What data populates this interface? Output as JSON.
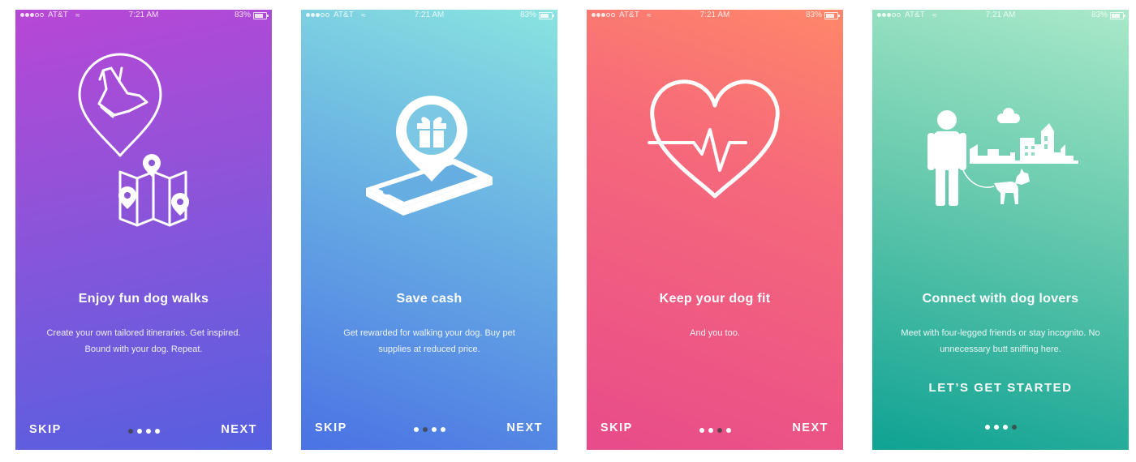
{
  "status_bar": {
    "carrier": "AT&T",
    "time": "7:21 AM",
    "battery": "83%"
  },
  "screens": [
    {
      "title": "Enjoy fun dog walks",
      "description": "Create your own tailored itineraries. Get inspired. Bound with your dog. Repeat.",
      "skip": "SKIP",
      "next": "NEXT",
      "active_page": 1,
      "illustration": "dog-map-pin-icon"
    },
    {
      "title": "Save cash",
      "description": "Get rewarded for walking your dog. Buy pet supplies at reduced price.",
      "skip": "SKIP",
      "next": "NEXT",
      "active_page": 2,
      "illustration": "gift-phone-icon"
    },
    {
      "title": "Keep your dog fit",
      "description": "And you too.",
      "skip": "SKIP",
      "next": "NEXT",
      "active_page": 3,
      "illustration": "heart-pulse-icon"
    },
    {
      "title": "Connect with dog lovers",
      "description": "Meet with four-legged friends or stay incognito. No unnecessary butt sniffing here.",
      "cta": "LET’S GET STARTED",
      "active_page": 4,
      "illustration": "person-dog-city-icon"
    }
  ],
  "page_count": 4,
  "colors": {
    "screen1": [
      "#b847d6",
      "#5560e0"
    ],
    "screen2": [
      "#8ae4e0",
      "#4a72e4"
    ],
    "screen3": [
      "#ff8769",
      "#e84b8a"
    ],
    "screen4": [
      "#a9e9c9",
      "#0fa293"
    ],
    "active_dot": "#404040"
  }
}
